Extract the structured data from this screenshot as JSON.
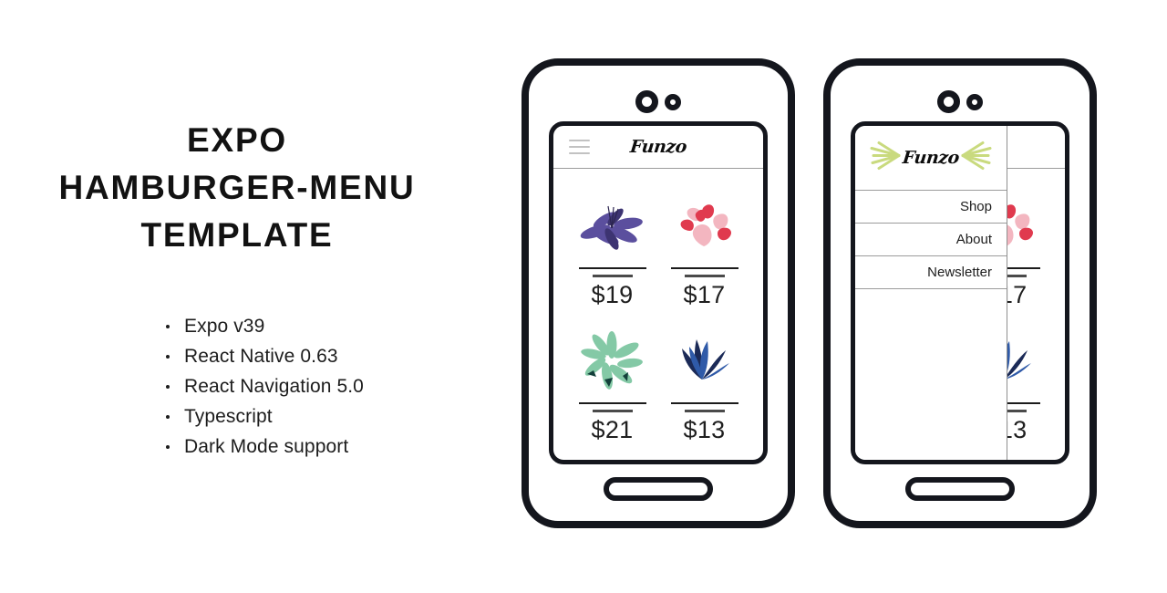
{
  "headline": {
    "line1": "EXPO",
    "line2": "HAMBURGER-MENU",
    "line3": "TEMPLATE"
  },
  "features": [
    "Expo v39",
    "React Native 0.63",
    "React Navigation 5.0",
    "Typescript",
    "Dark Mode support"
  ],
  "app": {
    "brand": "Funzo",
    "menu_icon": "hamburger-icon",
    "products": [
      {
        "price": "$19",
        "plant": "purple-fan-plant",
        "color": "#5b4f9e"
      },
      {
        "price": "$17",
        "plant": "red-pink-leaf-plant",
        "color": "#e03a4e"
      },
      {
        "price": "$21",
        "plant": "mint-star-plant",
        "color": "#7fc8a0"
      },
      {
        "price": "$13",
        "plant": "navy-blade-plant",
        "color": "#1e2c5c"
      }
    ],
    "drawer": {
      "brand": "Funzo",
      "ray_color": "#c9da7e",
      "items": [
        "Shop",
        "About",
        "Newsletter"
      ]
    }
  },
  "colors": {
    "frame": "#14161d",
    "text": "#121212",
    "divider": "#9b9b9b",
    "hamburger": "#c2c2c2"
  }
}
